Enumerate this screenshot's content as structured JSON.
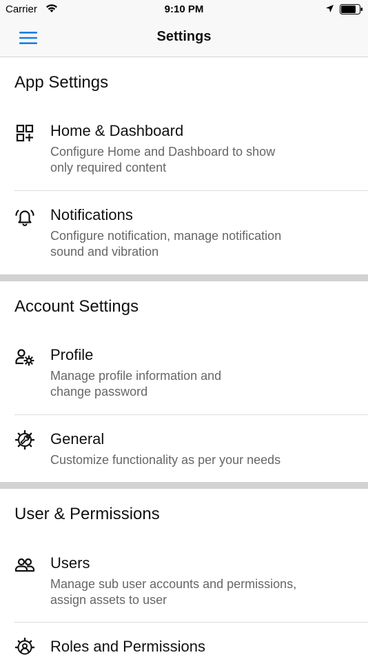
{
  "status_bar": {
    "carrier": "Carrier",
    "time": "9:10 PM",
    "icons": [
      "wifi-icon",
      "location-icon",
      "battery-icon"
    ]
  },
  "nav": {
    "title": "Settings",
    "menu_icon": "hamburger-menu-icon",
    "accent_color": "#1a7ee0"
  },
  "sections": [
    {
      "title": "App Settings",
      "items": [
        {
          "icon": "dashboard-grid-icon",
          "title": "Home & Dashboard",
          "desc_lines": [
            "Configure Home and Dashboard to show",
            "only required content"
          ]
        },
        {
          "icon": "bell-alarm-icon",
          "title": "Notifications",
          "desc_lines": [
            "Configure notification, manage notification",
            "sound and vibration"
          ]
        }
      ]
    },
    {
      "title": "Account Settings",
      "items": [
        {
          "icon": "user-gear-icon",
          "title": "Profile",
          "desc_lines": [
            "Manage profile information and",
            "change password"
          ]
        },
        {
          "icon": "wrench-gear-icon",
          "title": "General",
          "desc_lines": [
            "Customize functionality as per your needs"
          ]
        }
      ]
    },
    {
      "title": "User & Permissions",
      "items": [
        {
          "icon": "users-icon",
          "title": "Users",
          "desc_lines": [
            "Manage sub user accounts and permissions,",
            "assign assets to user"
          ]
        },
        {
          "icon": "user-gear-circle-icon",
          "title": "Roles and Permissions",
          "desc_lines": []
        }
      ]
    }
  ]
}
